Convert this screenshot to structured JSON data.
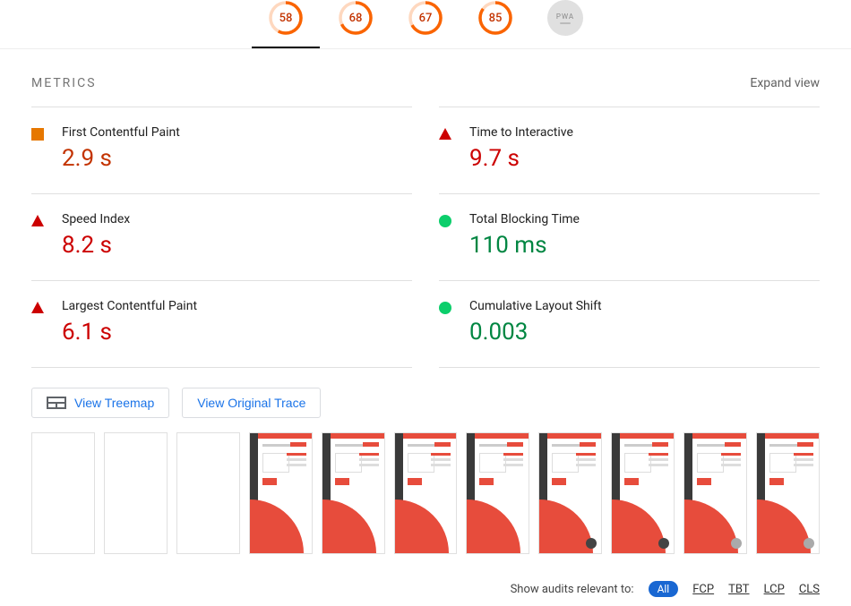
{
  "gauges": {
    "items": [
      {
        "score": "58",
        "pct": 58,
        "color": "orange",
        "selected": true
      },
      {
        "score": "68",
        "pct": 68,
        "color": "orange",
        "selected": false
      },
      {
        "score": "67",
        "pct": 67,
        "color": "orange",
        "selected": false
      },
      {
        "score": "85",
        "pct": 85,
        "color": "orange",
        "selected": false
      }
    ],
    "pwa_label": "PWA"
  },
  "section_title": "METRICS",
  "expand_label": "Expand view",
  "metrics": [
    {
      "label": "First Contentful Paint",
      "value": "2.9 s",
      "status": "avg",
      "icon": "square"
    },
    {
      "label": "Time to Interactive",
      "value": "9.7 s",
      "status": "bad",
      "icon": "triangle"
    },
    {
      "label": "Speed Index",
      "value": "8.2 s",
      "status": "bad",
      "icon": "triangle"
    },
    {
      "label": "Total Blocking Time",
      "value": "110 ms",
      "status": "good",
      "icon": "circle"
    },
    {
      "label": "Largest Contentful Paint",
      "value": "6.1 s",
      "status": "bad",
      "icon": "triangle"
    },
    {
      "label": "Cumulative Layout Shift",
      "value": "0.003",
      "status": "good",
      "icon": "circle"
    }
  ],
  "actions": {
    "treemap": "View Treemap",
    "trace": "View Original Trace"
  },
  "filmstrip_frames": [
    {
      "state": "blank"
    },
    {
      "state": "blank"
    },
    {
      "state": "blank"
    },
    {
      "state": "loaded",
      "fab": "none"
    },
    {
      "state": "loaded",
      "fab": "none"
    },
    {
      "state": "loaded",
      "fab": "none"
    },
    {
      "state": "loaded",
      "fab": "none"
    },
    {
      "state": "loaded",
      "fab": "dark"
    },
    {
      "state": "loaded",
      "fab": "dark"
    },
    {
      "state": "loaded",
      "fab": "light"
    },
    {
      "state": "loaded",
      "fab": "light"
    }
  ],
  "filters": {
    "prompt": "Show audits relevant to:",
    "pill": "All",
    "links": [
      "FCP",
      "TBT",
      "LCP",
      "CLS"
    ]
  }
}
